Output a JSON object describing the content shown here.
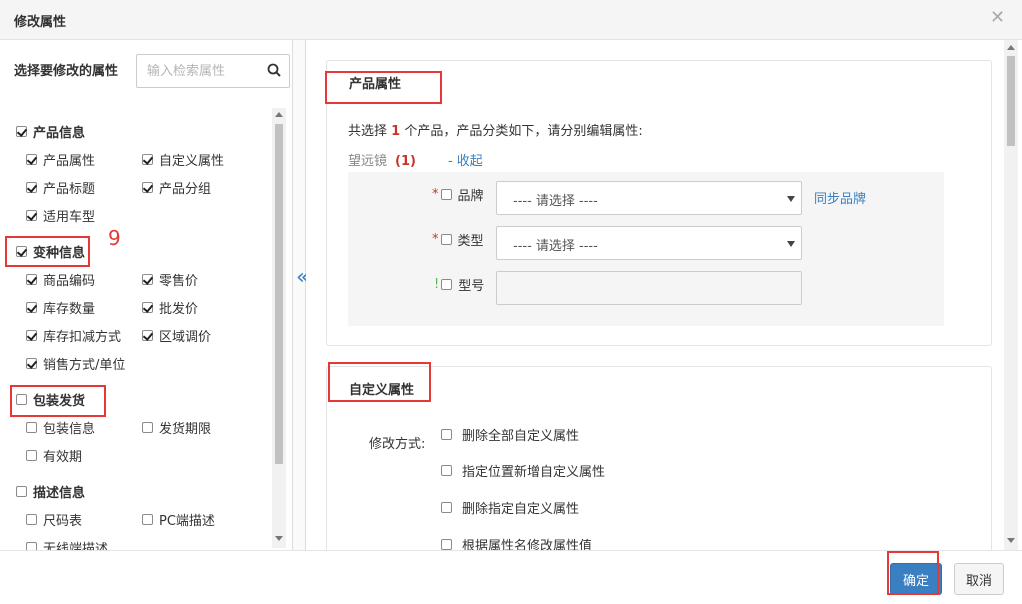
{
  "dialog": {
    "title": "修改属性"
  },
  "left": {
    "heading": "选择要修改的属性",
    "search_placeholder": "输入检索属性",
    "groups": [
      {
        "title": "产品信息",
        "checked": true,
        "items": [
          {
            "label": "产品属性",
            "checked": true
          },
          {
            "label": "自定义属性",
            "checked": true
          },
          {
            "label": "产品标题",
            "checked": true
          },
          {
            "label": "产品分组",
            "checked": true
          },
          {
            "label": "适用车型",
            "checked": true
          }
        ]
      },
      {
        "title": "变种信息",
        "checked": true,
        "items": [
          {
            "label": "商品编码",
            "checked": true
          },
          {
            "label": "零售价",
            "checked": true
          },
          {
            "label": "库存数量",
            "checked": true
          },
          {
            "label": "批发价",
            "checked": true
          },
          {
            "label": "库存扣减方式",
            "checked": true
          },
          {
            "label": "区域调价",
            "checked": true
          },
          {
            "label": "销售方式/单位",
            "checked": true
          }
        ]
      },
      {
        "title": "包装发货",
        "checked": false,
        "items": [
          {
            "label": "包装信息",
            "checked": false
          },
          {
            "label": "发货期限",
            "checked": false
          },
          {
            "label": "有效期",
            "checked": false
          }
        ]
      },
      {
        "title": "描述信息",
        "checked": false,
        "items": [
          {
            "label": "尺码表",
            "checked": false
          },
          {
            "label": "PC端描述",
            "checked": false
          },
          {
            "label": "无线端描述",
            "checked": false
          }
        ]
      }
    ]
  },
  "annotation_number": "9",
  "product_section": {
    "title": "产品属性",
    "summary_prefix": "共选择",
    "summary_count": "1",
    "summary_suffix": "个产品，产品分类如下，请分别编辑属性:",
    "category_name": "望远镜",
    "category_count": "(1)",
    "collapse_label": "- 收起",
    "fields": {
      "brand_label": "品牌",
      "brand_value": "---- 请选择 ----",
      "sync_brand": "同步品牌",
      "type_label": "类型",
      "type_value": "---- 请选择 ----",
      "model_label": "型号",
      "required_mark": "*",
      "warn_mark": "!"
    }
  },
  "custom_section": {
    "title": "自定义属性",
    "mode_label": "修改方式:",
    "options": [
      "删除全部自定义属性",
      "指定位置新增自定义属性",
      "删除指定自定义属性",
      "根据属性名修改属性值"
    ]
  },
  "footer": {
    "ok": "确定",
    "cancel": "取消"
  },
  "colors": {
    "accent": "#3a7fc1",
    "annotation": "#e53935",
    "required": "#c0392b"
  }
}
